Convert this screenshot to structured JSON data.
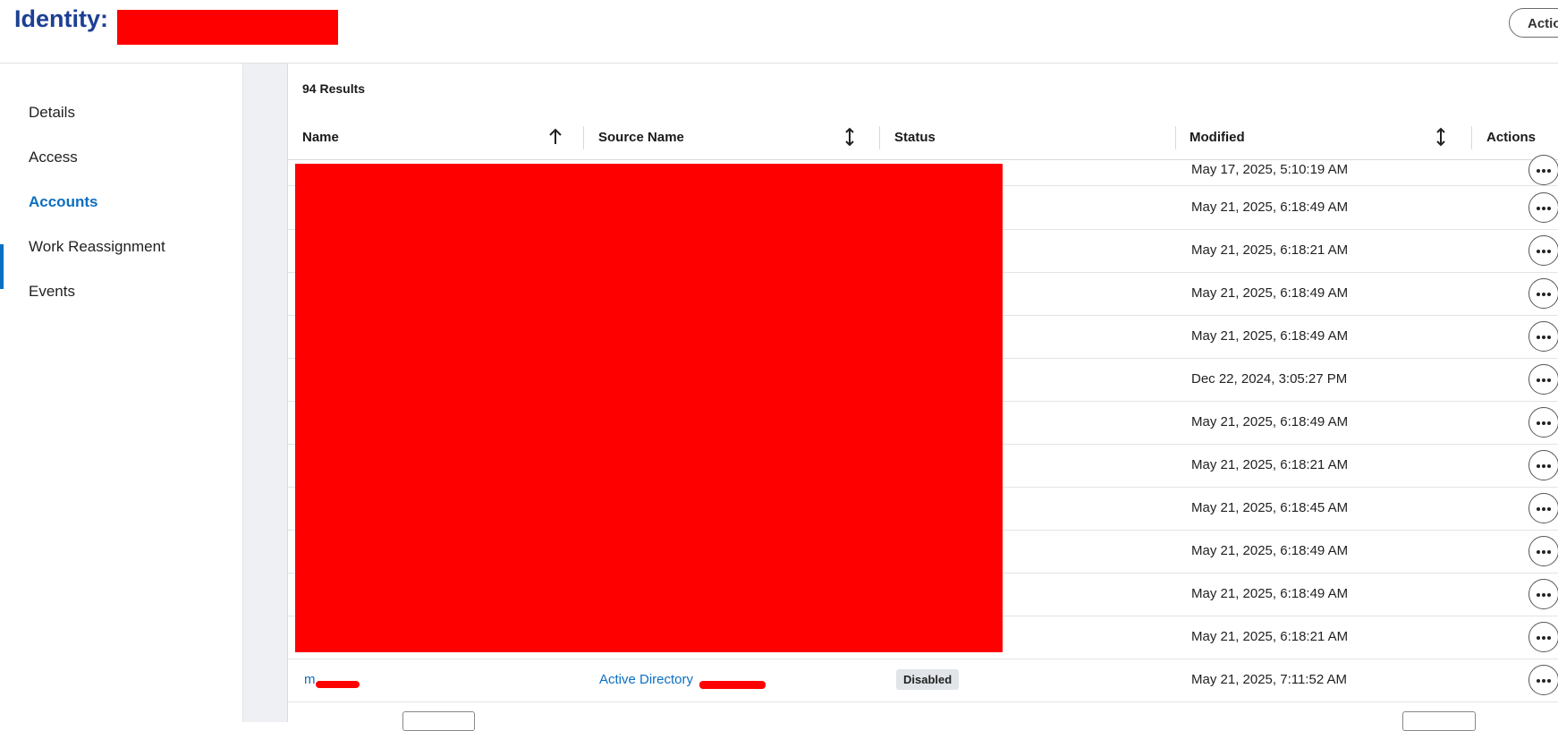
{
  "header": {
    "title": "Identity:",
    "actions_label": "Actions"
  },
  "sidebar": {
    "items": [
      {
        "label": "Details",
        "active": false
      },
      {
        "label": "Access",
        "active": false
      },
      {
        "label": "Accounts",
        "active": true
      },
      {
        "label": "Work Reassignment",
        "active": false
      },
      {
        "label": "Events",
        "active": false
      }
    ]
  },
  "results": {
    "count_label": "94 Results"
  },
  "table": {
    "columns": {
      "name": "Name",
      "source": "Source Name",
      "status": "Status",
      "modified": "Modified",
      "actions": "Actions"
    },
    "sort": {
      "name": "ascending",
      "source": "sortable",
      "modified": "sortable"
    },
    "rows": [
      {
        "modified": "May 17, 2025, 5:10:19 AM"
      },
      {
        "modified": "May 21, 2025, 6:18:49 AM"
      },
      {
        "modified": "May 21, 2025, 6:18:21 AM"
      },
      {
        "modified": "May 21, 2025, 6:18:49 AM"
      },
      {
        "modified": "May 21, 2025, 6:18:49 AM"
      },
      {
        "modified": "Dec 22, 2024, 3:05:27 PM"
      },
      {
        "modified": "May 21, 2025, 6:18:49 AM"
      },
      {
        "modified": "May 21, 2025, 6:18:21 AM"
      },
      {
        "modified": "May 21, 2025, 6:18:45 AM"
      },
      {
        "modified": "May 21, 2025, 6:18:49 AM"
      },
      {
        "modified": "May 21, 2025, 6:18:49 AM"
      },
      {
        "modified": "May 21, 2025, 6:18:21 AM"
      }
    ],
    "last_row": {
      "name_prefix": "m",
      "source": "Active Directory",
      "status": "Disabled",
      "modified": "May 21, 2025, 7:11:52 AM"
    }
  },
  "colors": {
    "accent": "#0b6fc2",
    "title": "#1d3f94",
    "redaction": "#ff0000"
  }
}
